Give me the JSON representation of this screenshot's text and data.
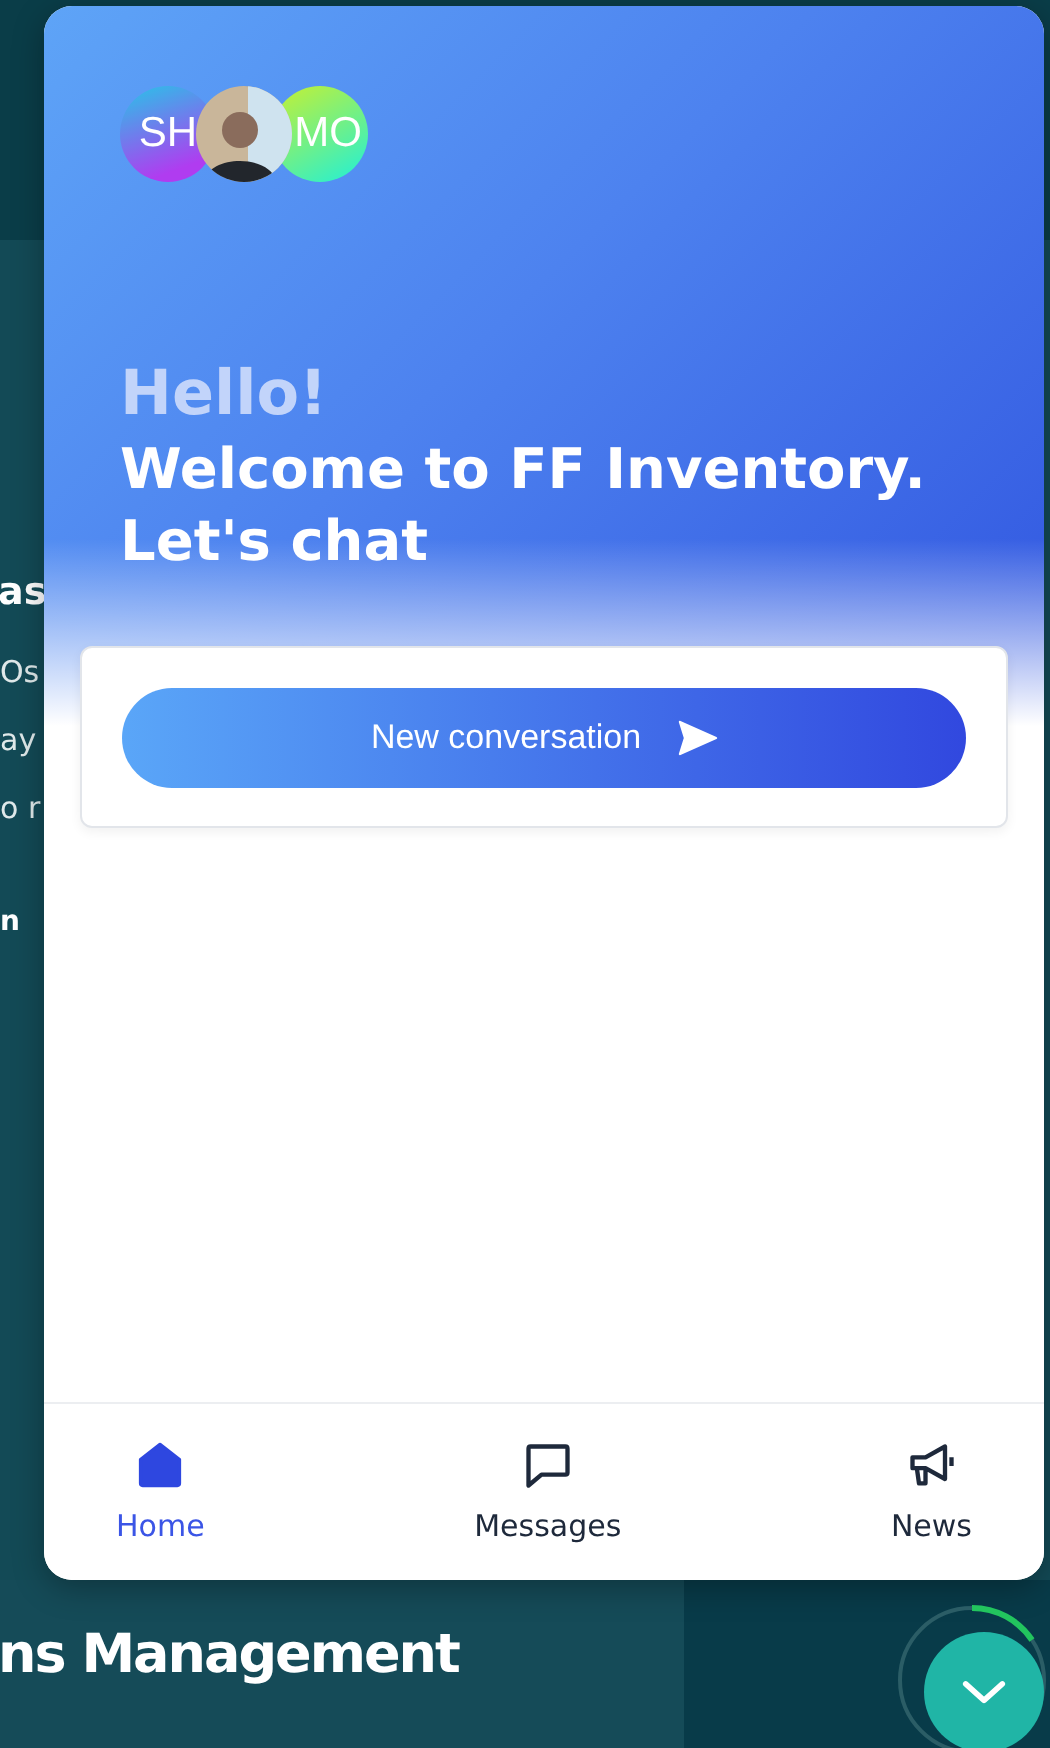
{
  "background_texts": [
    {
      "kind": "heading",
      "text": "as"
    },
    {
      "kind": "body",
      "text": "Os"
    },
    {
      "kind": "body",
      "text": "ay"
    },
    {
      "kind": "body",
      "text": "o r"
    },
    {
      "kind": "link",
      "text": "n"
    }
  ],
  "background_title": "ns Management",
  "avatars": [
    {
      "kind": "initials",
      "initials": "SH"
    },
    {
      "kind": "photo"
    },
    {
      "kind": "initials",
      "initials": "MO"
    }
  ],
  "greeting": "Hello!",
  "welcome": "Welcome to FF Inventory. Let's chat",
  "new_conversation_button": "New conversation",
  "nav_tabs": [
    {
      "label": "Home",
      "selected": true
    },
    {
      "label": "Messages",
      "selected": false
    },
    {
      "label": "News",
      "selected": false
    }
  ]
}
